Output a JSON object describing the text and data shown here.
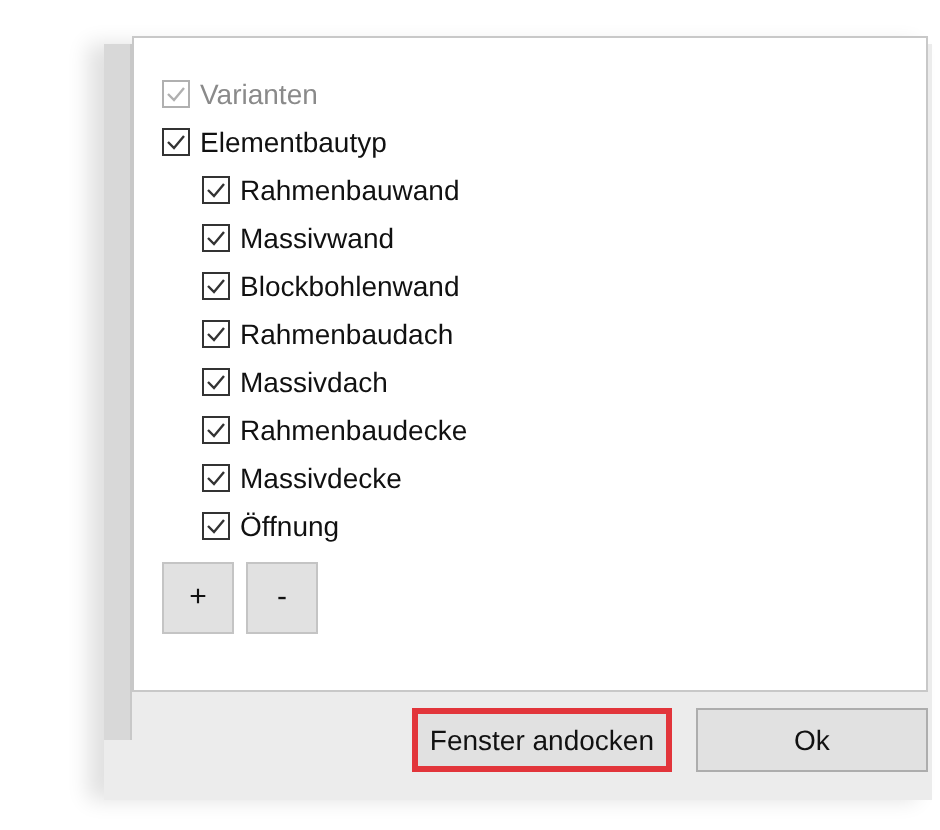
{
  "options": [
    {
      "label": "Varianten",
      "checked": true,
      "disabled": true
    },
    {
      "label": "Elementbautyp",
      "checked": true,
      "disabled": false,
      "children": [
        {
          "label": "Rahmenbauwand",
          "checked": true
        },
        {
          "label": "Massivwand",
          "checked": true
        },
        {
          "label": "Blockbohlenwand",
          "checked": true
        },
        {
          "label": "Rahmenbaudach",
          "checked": true
        },
        {
          "label": "Massivdach",
          "checked": true
        },
        {
          "label": "Rahmenbaudecke",
          "checked": true
        },
        {
          "label": "Massivdecke",
          "checked": true
        },
        {
          "label": "Öffnung",
          "checked": true
        }
      ]
    }
  ],
  "list_buttons": [
    "+",
    "-"
  ],
  "buttons": [
    {
      "label": "Fenster andocken",
      "highlighted": true
    },
    {
      "label": "Ok",
      "highlighted": false
    }
  ]
}
